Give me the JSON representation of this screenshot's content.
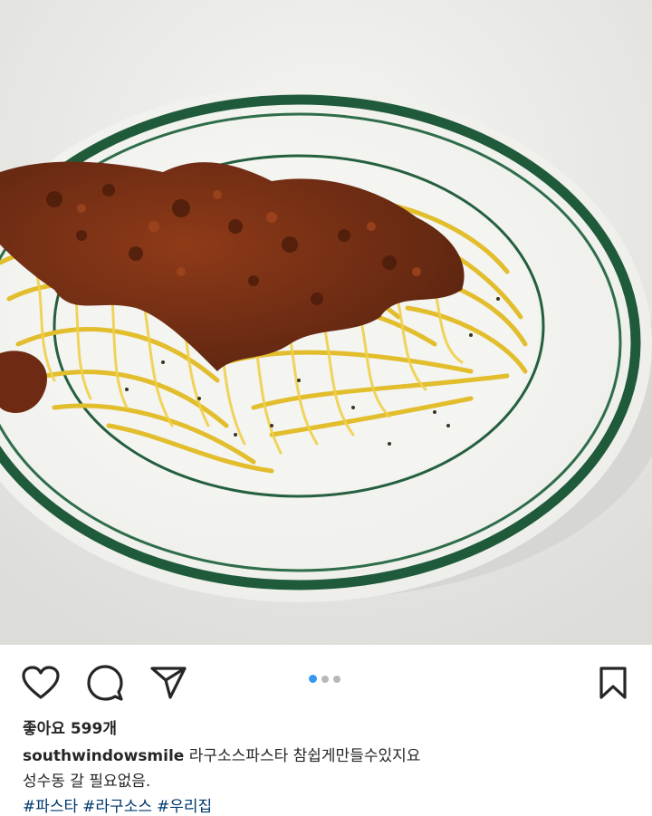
{
  "post": {
    "photo_alt": "",
    "carousel": {
      "count": 3,
      "active_index": 0
    },
    "likes_label": "좋아요 599개",
    "username": "southwindowsmile",
    "caption_line1": "라구소스파스타 참쉽게만들수있지요",
    "caption_line2": "성수동 갈 필요없음.",
    "hashtags": [
      "#파스타",
      "#라구소스",
      "#우리집"
    ]
  },
  "icons": {
    "like": "heart-icon",
    "comment": "comment-bubble-icon",
    "share": "paper-plane-icon",
    "save": "bookmark-icon"
  },
  "colors": {
    "plate_band": "#1f5a3a",
    "pasta": "#e7c436",
    "sauce": "#7a2e14",
    "carousel_active": "#3897f0",
    "hashtag": "#00376b"
  }
}
